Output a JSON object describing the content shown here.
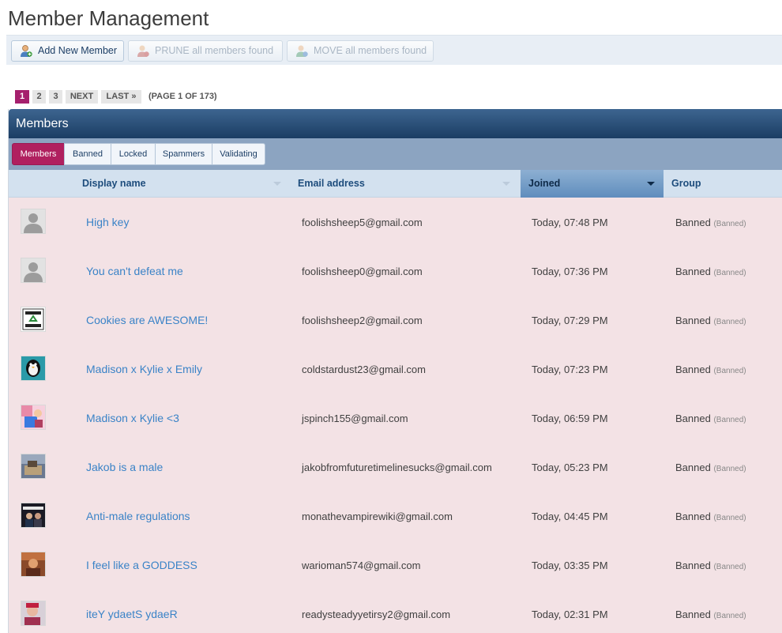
{
  "page": {
    "title": "Member Management"
  },
  "toolbar": {
    "add_label": "Add New Member",
    "prune_label": "PRUNE all members found",
    "move_label": "MOVE all members found"
  },
  "pagination": {
    "pages": [
      "1",
      "2",
      "3"
    ],
    "current": "1",
    "next_label": "NEXT",
    "last_label": "LAST »",
    "info": "(PAGE 1 OF 173)"
  },
  "panel": {
    "title": "Members",
    "tabs": [
      "Members",
      "Banned",
      "Locked",
      "Spammers",
      "Validating"
    ],
    "active_tab": "Members"
  },
  "table": {
    "columns": [
      "Display name",
      "Email address",
      "Joined",
      "Group"
    ],
    "sorted_column": "Joined",
    "rows": [
      {
        "avatar": "default-avatar-icon",
        "name": "High key",
        "email": "foolishsheep5@gmail.com",
        "joined": "Today, 07:48 PM",
        "group": "Banned",
        "group_tag": "(Banned)"
      },
      {
        "avatar": "default-avatar-icon",
        "name": "You can't defeat me",
        "email": "foolishsheep0@gmail.com",
        "joined": "Today, 07:36 PM",
        "group": "Banned",
        "group_tag": "(Banned)"
      },
      {
        "avatar": "recycle-sign-avatar",
        "name": "Cookies are AWESOME!",
        "email": "foolishsheep2@gmail.com",
        "joined": "Today, 07:29 PM",
        "group": "Banned",
        "group_tag": "(Banned)"
      },
      {
        "avatar": "penguin-avatar",
        "name": "Madison x Kylie x Emily",
        "email": "coldstardust23@gmail.com",
        "joined": "Today, 07:23 PM",
        "group": "Banned",
        "group_tag": "(Banned)"
      },
      {
        "avatar": "cartoon-avatar",
        "name": "Madison x Kylie <3",
        "email": "jspinch155@gmail.com",
        "joined": "Today, 06:59 PM",
        "group": "Banned",
        "group_tag": "(Banned)"
      },
      {
        "avatar": "photo-avatar",
        "name": "Jakob is a male",
        "email": "jakobfromfuturetimelinesucks@gmail.com",
        "joined": "Today, 05:23 PM",
        "group": "Banned",
        "group_tag": "(Banned)"
      },
      {
        "avatar": "photo-avatar",
        "name": "Anti-male regulations",
        "email": "monathevampirewiki@gmail.com",
        "joined": "Today, 04:45 PM",
        "group": "Banned",
        "group_tag": "(Banned)"
      },
      {
        "avatar": "photo-avatar",
        "name": "I feel like a GODDESS",
        "email": "warioman574@gmail.com",
        "joined": "Today, 03:35 PM",
        "group": "Banned",
        "group_tag": "(Banned)"
      },
      {
        "avatar": "photo-avatar",
        "name": "iteY ydaetS ydaeR",
        "email": "readysteadyyetirsy2@gmail.com",
        "joined": "Today, 02:31 PM",
        "group": "Banned",
        "group_tag": "(Banned)"
      }
    ]
  },
  "colors": {
    "accent": "#a5206d",
    "link": "#3a83c7",
    "row_background": "#f3e2e5",
    "header_blue": "#1b3d63"
  }
}
